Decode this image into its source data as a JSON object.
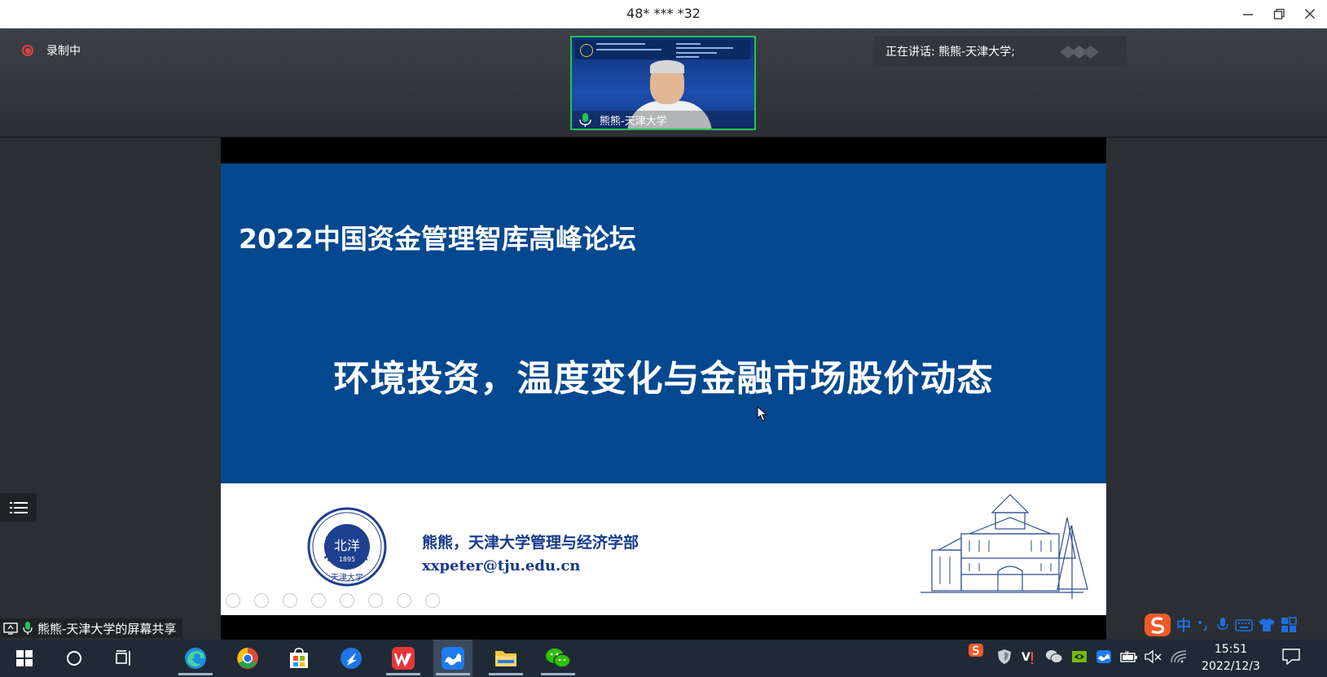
{
  "window": {
    "title": "48* *** *32"
  },
  "recording": {
    "label": "录制中"
  },
  "video": {
    "participant": "熊熊-天津大学"
  },
  "speaking": {
    "label": "正在讲话: 熊熊-天津大学;"
  },
  "slide": {
    "title": "2022中国资金管理智库高峰论坛",
    "main": "环境投资，温度变化与金融市场股价动态",
    "author": "熊熊，天津大学管理与经济学部",
    "email": "xxpeter@tju.edu.cn",
    "seal_text": "TIANJIN UNIVERSITY (PEIYANG UNIVERSITY)",
    "seal_year": "1895",
    "seal_center": "北洋",
    "seal_bottom": "天津大学"
  },
  "share": {
    "label": "熊熊-天津大学的屏幕共享"
  },
  "ime": {
    "mode": "中"
  },
  "clock": {
    "time": "15:51",
    "date": "2022/12/3"
  },
  "colors": {
    "slide_blue": "#04488f",
    "active_speaker_border": "#23c552",
    "record_red": "#e14040"
  }
}
